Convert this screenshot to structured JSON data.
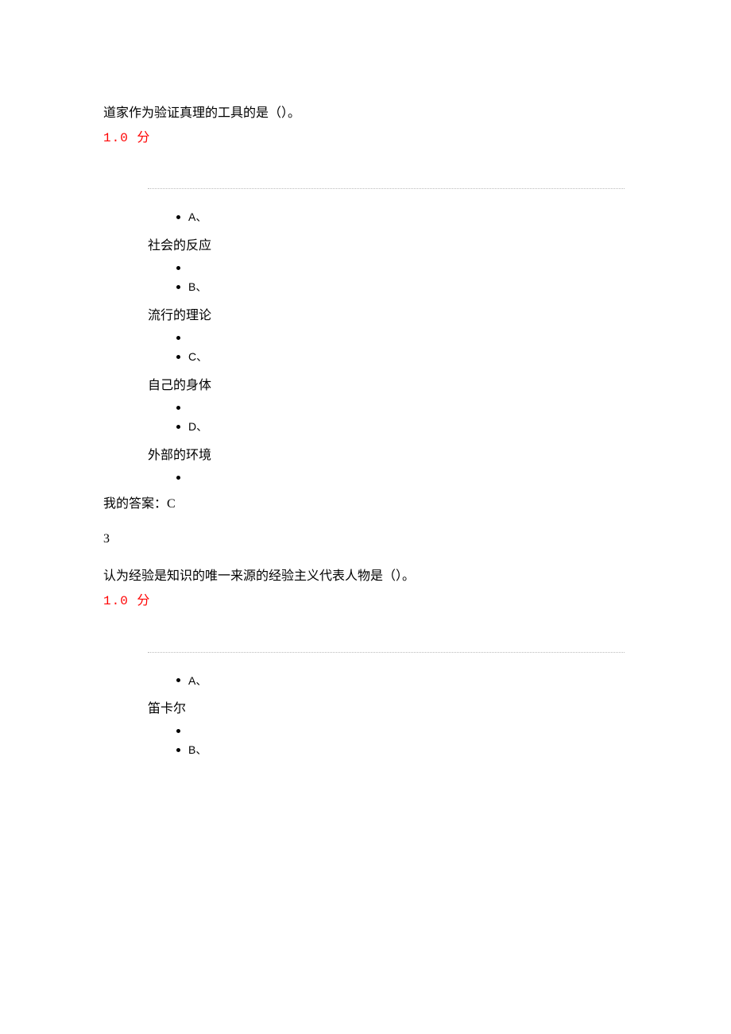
{
  "q1": {
    "stem": "道家作为验证真理的工具的是（）。",
    "score": "1.0  分",
    "letters": [
      "A、",
      "B、",
      "C、",
      "D、"
    ],
    "options": [
      "社会的反应",
      "流行的理论",
      "自己的身体",
      "外部的环境"
    ],
    "myAnswerLabel": "我的答案：",
    "myAnswerValue": "C"
  },
  "q2": {
    "number": "3",
    "stem": "认为经验是知识的唯一来源的经验主义代表人物是（）。",
    "score": "1.0  分",
    "letters": [
      "A、",
      "B、"
    ],
    "options": [
      "笛卡尔"
    ]
  }
}
